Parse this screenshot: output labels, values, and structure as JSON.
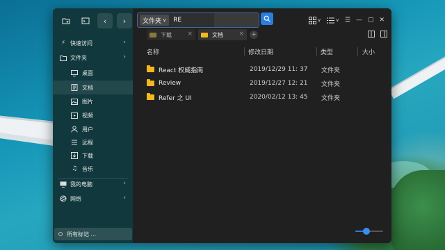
{
  "toolbar": {
    "address_tag": "文件夹",
    "address_text": "RE"
  },
  "tabs": [
    {
      "label": "下载",
      "active": false
    },
    {
      "label": "文档",
      "active": true
    }
  ],
  "columns": {
    "name": "名称",
    "date": "修改日期",
    "type": "类型",
    "size": "大小"
  },
  "files": [
    {
      "name": "React 权威指南",
      "date": "2019/12/29 11:  37",
      "type": "文件夹"
    },
    {
      "name": "Review",
      "date": "2019/12/27 12:  21",
      "type": "文件夹"
    },
    {
      "name": "Refer 之 UI",
      "date": "2020/02/12 13:  45",
      "type": "文件夹"
    }
  ],
  "sidebar": {
    "quick_access": "快速访问",
    "files": "文件夹",
    "items": [
      {
        "label": "桌面",
        "icon": "desktop-icon"
      },
      {
        "label": "文档",
        "icon": "document-icon"
      },
      {
        "label": "图片",
        "icon": "image-icon"
      },
      {
        "label": "视频",
        "icon": "video-icon"
      },
      {
        "label": "用户",
        "icon": "user-icon"
      },
      {
        "label": "远程",
        "icon": "remote-icon"
      },
      {
        "label": "下载",
        "icon": "download-icon"
      },
      {
        "label": "音乐",
        "icon": "music-icon"
      }
    ],
    "my_computer": "我的电脑",
    "network": "网络",
    "tags": "所有标记 ..."
  },
  "zoom": {
    "value": 0.35
  },
  "colors": {
    "accent": "#2a7ee0",
    "folder": "#f3b81f",
    "sidebar": "#103c40",
    "main": "#202020"
  }
}
